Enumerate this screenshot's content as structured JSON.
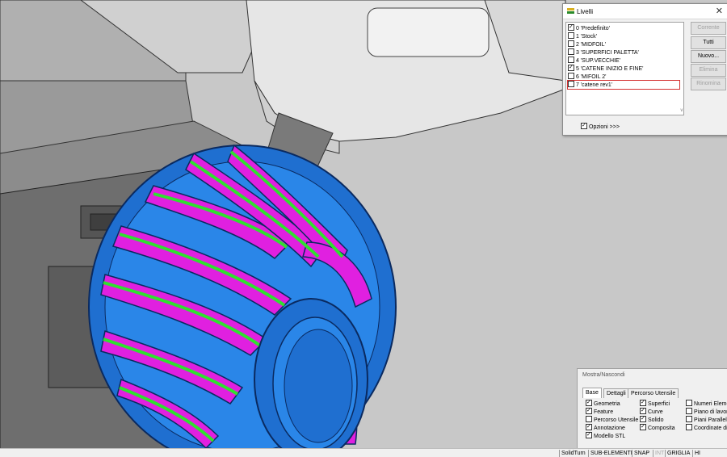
{
  "layers_dialog": {
    "title": "Livelli",
    "close_symbol": "✕",
    "layers": [
      {
        "label": "0 'Predefinito'",
        "checked": true
      },
      {
        "label": "1 'Stock'",
        "checked": false
      },
      {
        "label": "2 'MIDFOIL'",
        "checked": false
      },
      {
        "label": "3 'SUPERFICI PALETTA'",
        "checked": false
      },
      {
        "label": "4 'SUP.VECCHIE'",
        "checked": false
      },
      {
        "label": "5 'CATENE INIZIO E FINE'",
        "checked": true
      },
      {
        "label": "6 'MIFOIL 2'",
        "checked": false
      },
      {
        "label": "7 'catene rev1'",
        "checked": false,
        "selected": true
      }
    ],
    "buttons": {
      "current": "Corrente",
      "all": "Tutti",
      "new": "Nuovo...",
      "delete": "Elimina",
      "rename": "Rinomina"
    },
    "options_label": "Opzioni >>>",
    "options_checked": true
  },
  "show_hide_panel": {
    "title": "Mostra/Nascondi",
    "tabs": [
      "Base",
      "Dettagli",
      "Percorso Utensile"
    ],
    "active_tab": "Base",
    "col1": [
      {
        "label": "Geometria",
        "checked": true
      },
      {
        "label": "Feature",
        "checked": true
      },
      {
        "label": "Percorso Utensile",
        "checked": false
      },
      {
        "label": "Annotazione",
        "checked": true
      },
      {
        "label": "Modello STL",
        "checked": true
      }
    ],
    "col2": [
      {
        "label": "Superfici",
        "checked": true
      },
      {
        "label": "Curve",
        "checked": true
      },
      {
        "label": "Solido",
        "checked": true
      },
      {
        "label": "Composita",
        "checked": true
      }
    ],
    "col3": [
      {
        "label": "Numeri Eleme",
        "checked": false
      },
      {
        "label": "Piano di lavor",
        "checked": false
      },
      {
        "label": "Piani Paralleli",
        "checked": false
      },
      {
        "label": "Coordinate di",
        "checked": false
      }
    ]
  },
  "status_bar": {
    "items": [
      "SolidTurn",
      "SUB-ELEMENTI",
      "SNAP",
      "INT",
      "GRIGLIA",
      "HI"
    ]
  },
  "colors": {
    "background": "#c8c8c8",
    "impeller_blue": "#1f7fe0",
    "blade_magenta": "#e020e0",
    "edge_green": "#30e030",
    "selection_red": "#d43030"
  }
}
